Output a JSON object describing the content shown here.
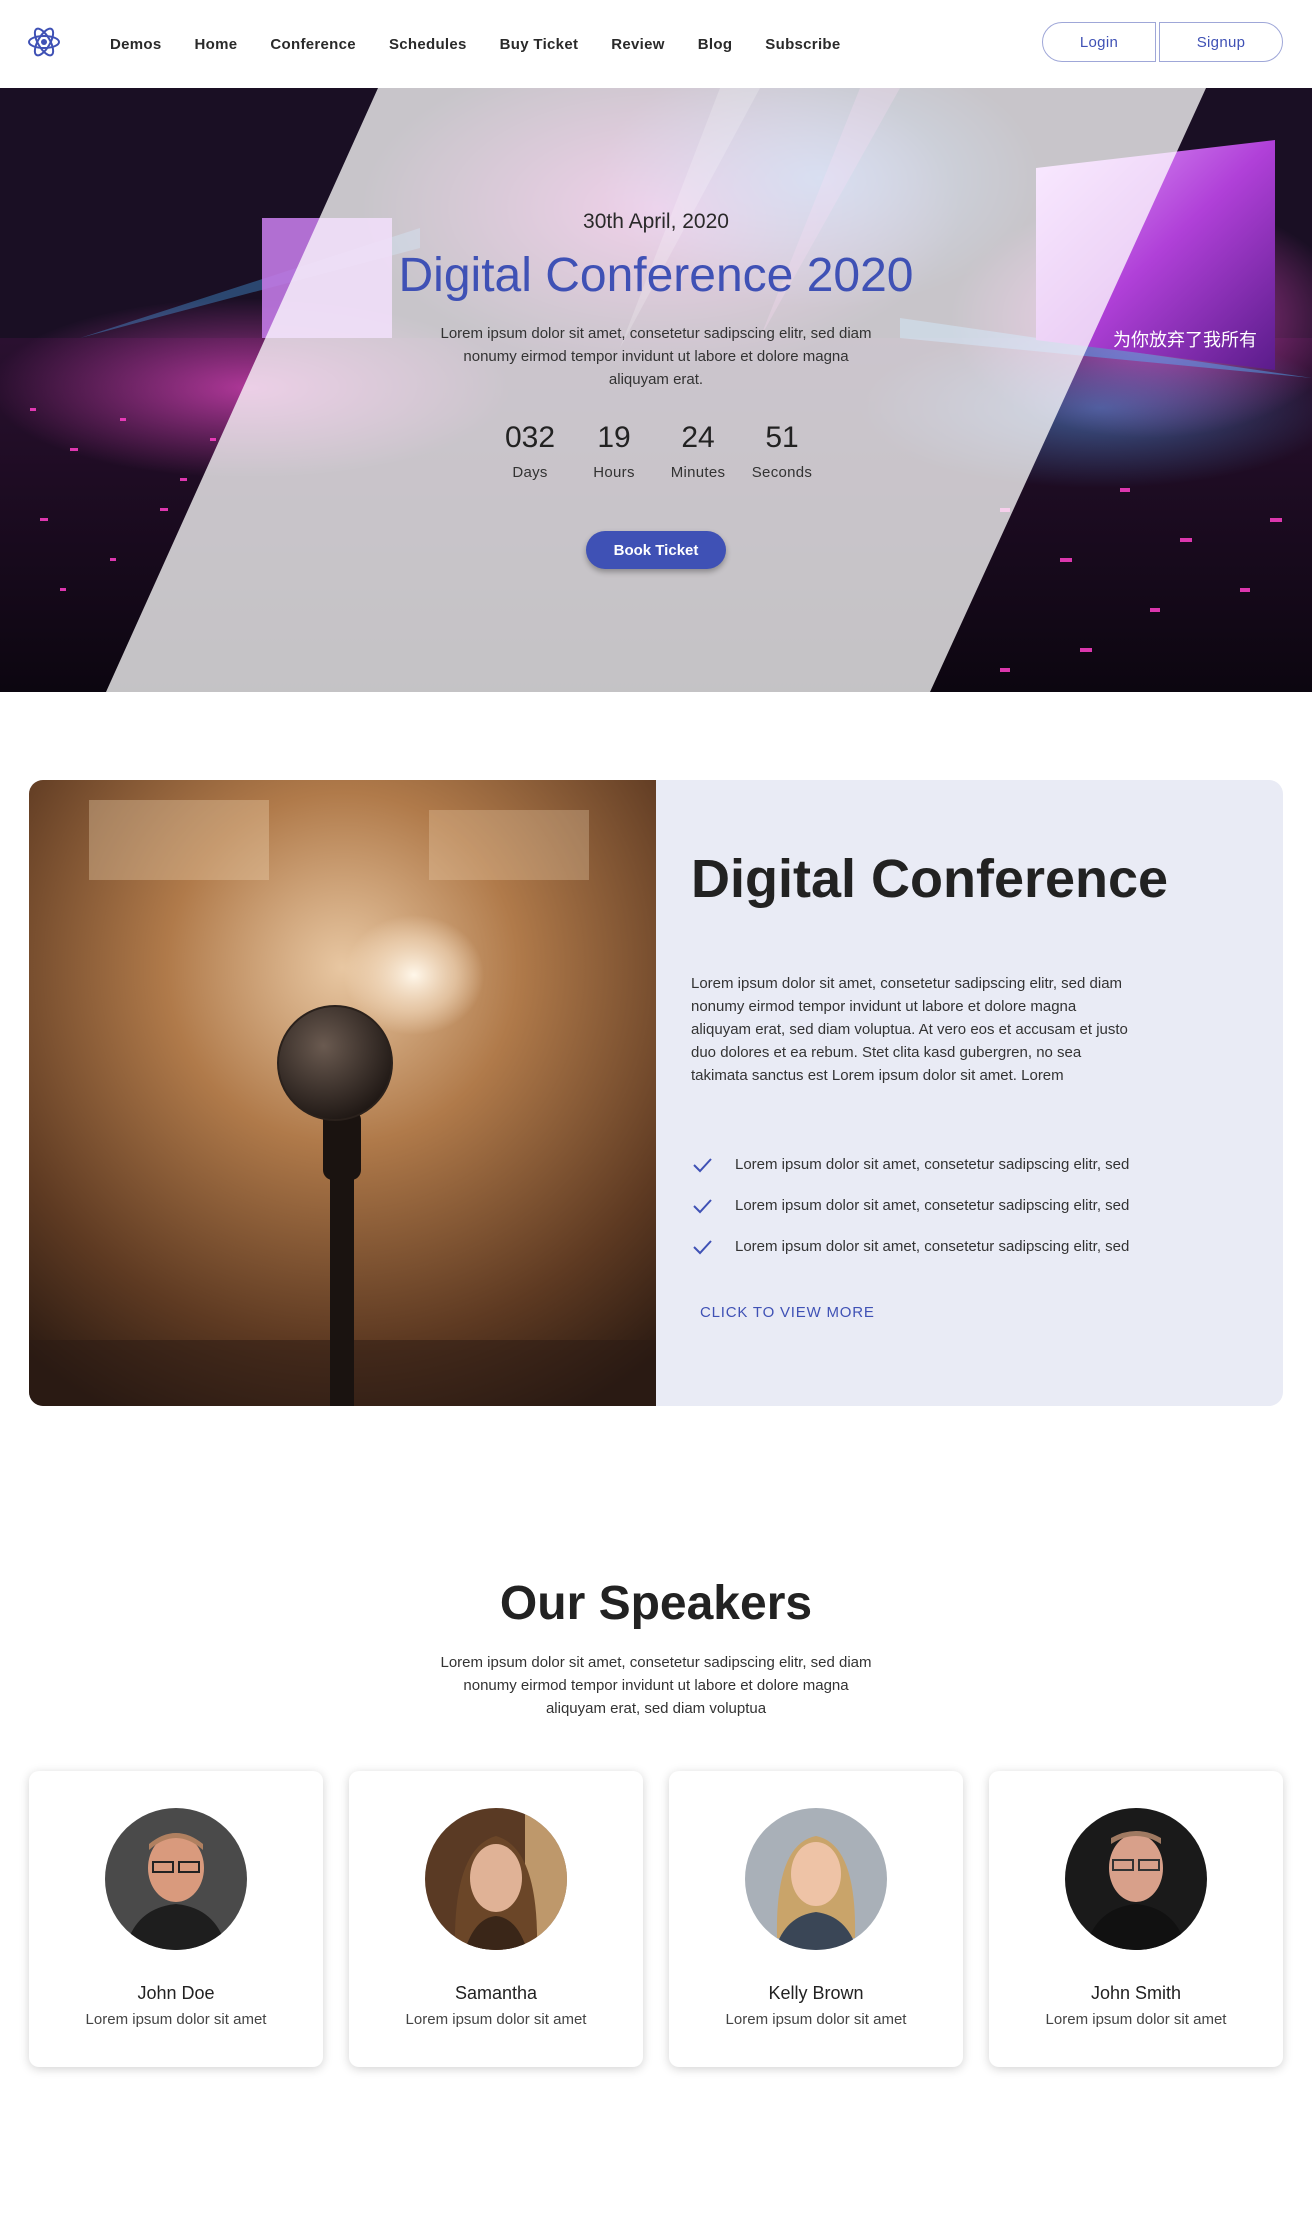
{
  "nav": {
    "logo": "atom-logo-icon",
    "links": [
      "Demos",
      "Home",
      "Conference",
      "Schedules",
      "Buy Ticket",
      "Review",
      "Blog",
      "Subscribe"
    ],
    "login": "Login",
    "signup": "Signup"
  },
  "hero": {
    "date": "30th April, 2020",
    "title": "Digital Conference 2020",
    "description": "Lorem ipsum dolor sit amet, consetetur sadipscing elitr, sed diam nonumy eirmod tempor invidunt ut labore et dolore magna aliquyam erat.",
    "countdown": [
      {
        "value": "032",
        "label": "Days"
      },
      {
        "value": "19",
        "label": "Hours"
      },
      {
        "value": "24",
        "label": "Minutes"
      },
      {
        "value": "51",
        "label": "Seconds"
      }
    ],
    "button": "Book Ticket",
    "screen_text": "为你放弃了我所有"
  },
  "about": {
    "title": "Digital Conference",
    "description": "Lorem ipsum dolor sit amet, consetetur sadipscing elitr, sed diam nonumy eirmod tempor invidunt ut labore et dolore magna aliquyam erat, sed diam voluptua. At vero eos et accusam et justo duo dolores et ea rebum. Stet clita kasd gubergren, no sea takimata sanctus est Lorem ipsum dolor sit amet. Lorem",
    "checks": [
      "Lorem ipsum dolor sit amet, consetetur sadipscing elitr, sed",
      "Lorem ipsum dolor sit amet, consetetur sadipscing elitr, sed",
      "Lorem ipsum dolor sit amet, consetetur sadipscing elitr, sed"
    ],
    "link": "CLICK TO VIEW MORE"
  },
  "speakers": {
    "title": "Our Speakers",
    "description": "Lorem ipsum dolor sit amet, consetetur sadipscing elitr, sed diam nonumy eirmod tempor invidunt ut labore et dolore magna aliquyam erat, sed diam voluptua",
    "list": [
      {
        "name": "John Doe",
        "role": "Lorem ipsum dolor sit amet"
      },
      {
        "name": "Samantha",
        "role": "Lorem ipsum dolor sit amet"
      },
      {
        "name": "Kelly Brown",
        "role": "Lorem ipsum dolor sit amet"
      },
      {
        "name": "John Smith",
        "role": "Lorem ipsum dolor sit amet"
      }
    ]
  },
  "colors": {
    "accent": "#3f51b5",
    "about_bg": "#e9ebf5"
  }
}
